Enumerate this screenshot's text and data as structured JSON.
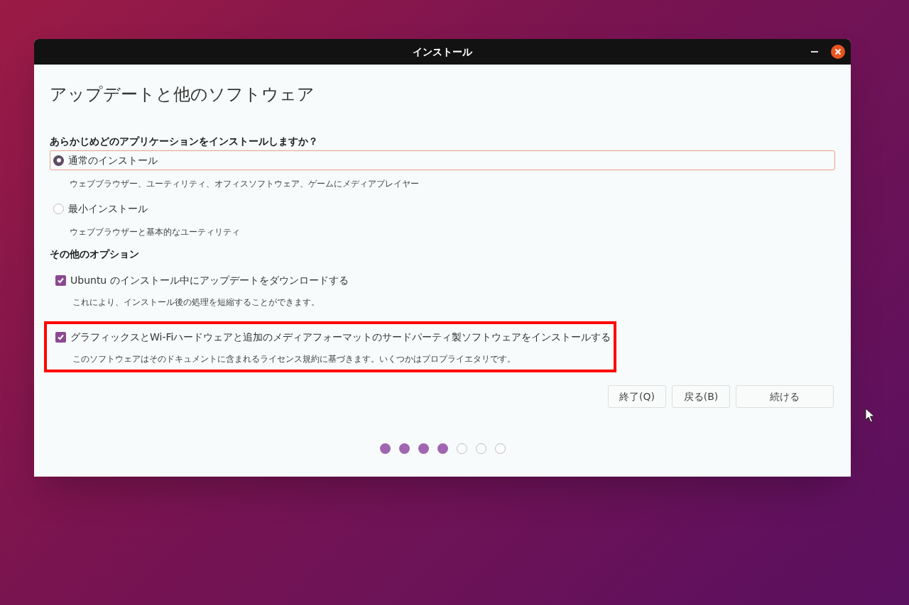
{
  "window": {
    "title": "インストール"
  },
  "heading": "アップデートと他のソフトウェア",
  "install_question": "あらかじめどのアプリケーションをインストールしますか？",
  "install_types": [
    {
      "label": "通常のインストール",
      "description": "ウェブブラウザー、ユーティリティ、オフィスソフトウェア、ゲームにメディアプレイヤー",
      "selected": true
    },
    {
      "label": "最小インストール",
      "description": "ウェブブラウザーと基本的なユーティリティ",
      "selected": false
    }
  ],
  "other_options_heading": "その他のオプション",
  "options": [
    {
      "label": "Ubuntu のインストール中にアップデートをダウンロードする",
      "description": "これにより、インストール後の処理を短縮することができます。",
      "checked": true,
      "highlighted": false
    },
    {
      "label": "グラフィックスとWi-Fiハードウェアと追加のメディアフォーマットのサードパーティ製ソフトウェアをインストールする",
      "description": "このソフトウェアはそのドキュメントに含まれるライセンス規約に基づきます。いくつかはプロプライエタリです。",
      "checked": true,
      "highlighted": true
    }
  ],
  "buttons": [
    "終了(Q)",
    "戻る(B)",
    "続ける"
  ],
  "progress": [
    {
      "filled": true
    },
    {
      "filled": true
    },
    {
      "filled": true
    },
    {
      "filled": true
    },
    {
      "filled": false
    },
    {
      "filled": false
    },
    {
      "filled": false
    }
  ]
}
